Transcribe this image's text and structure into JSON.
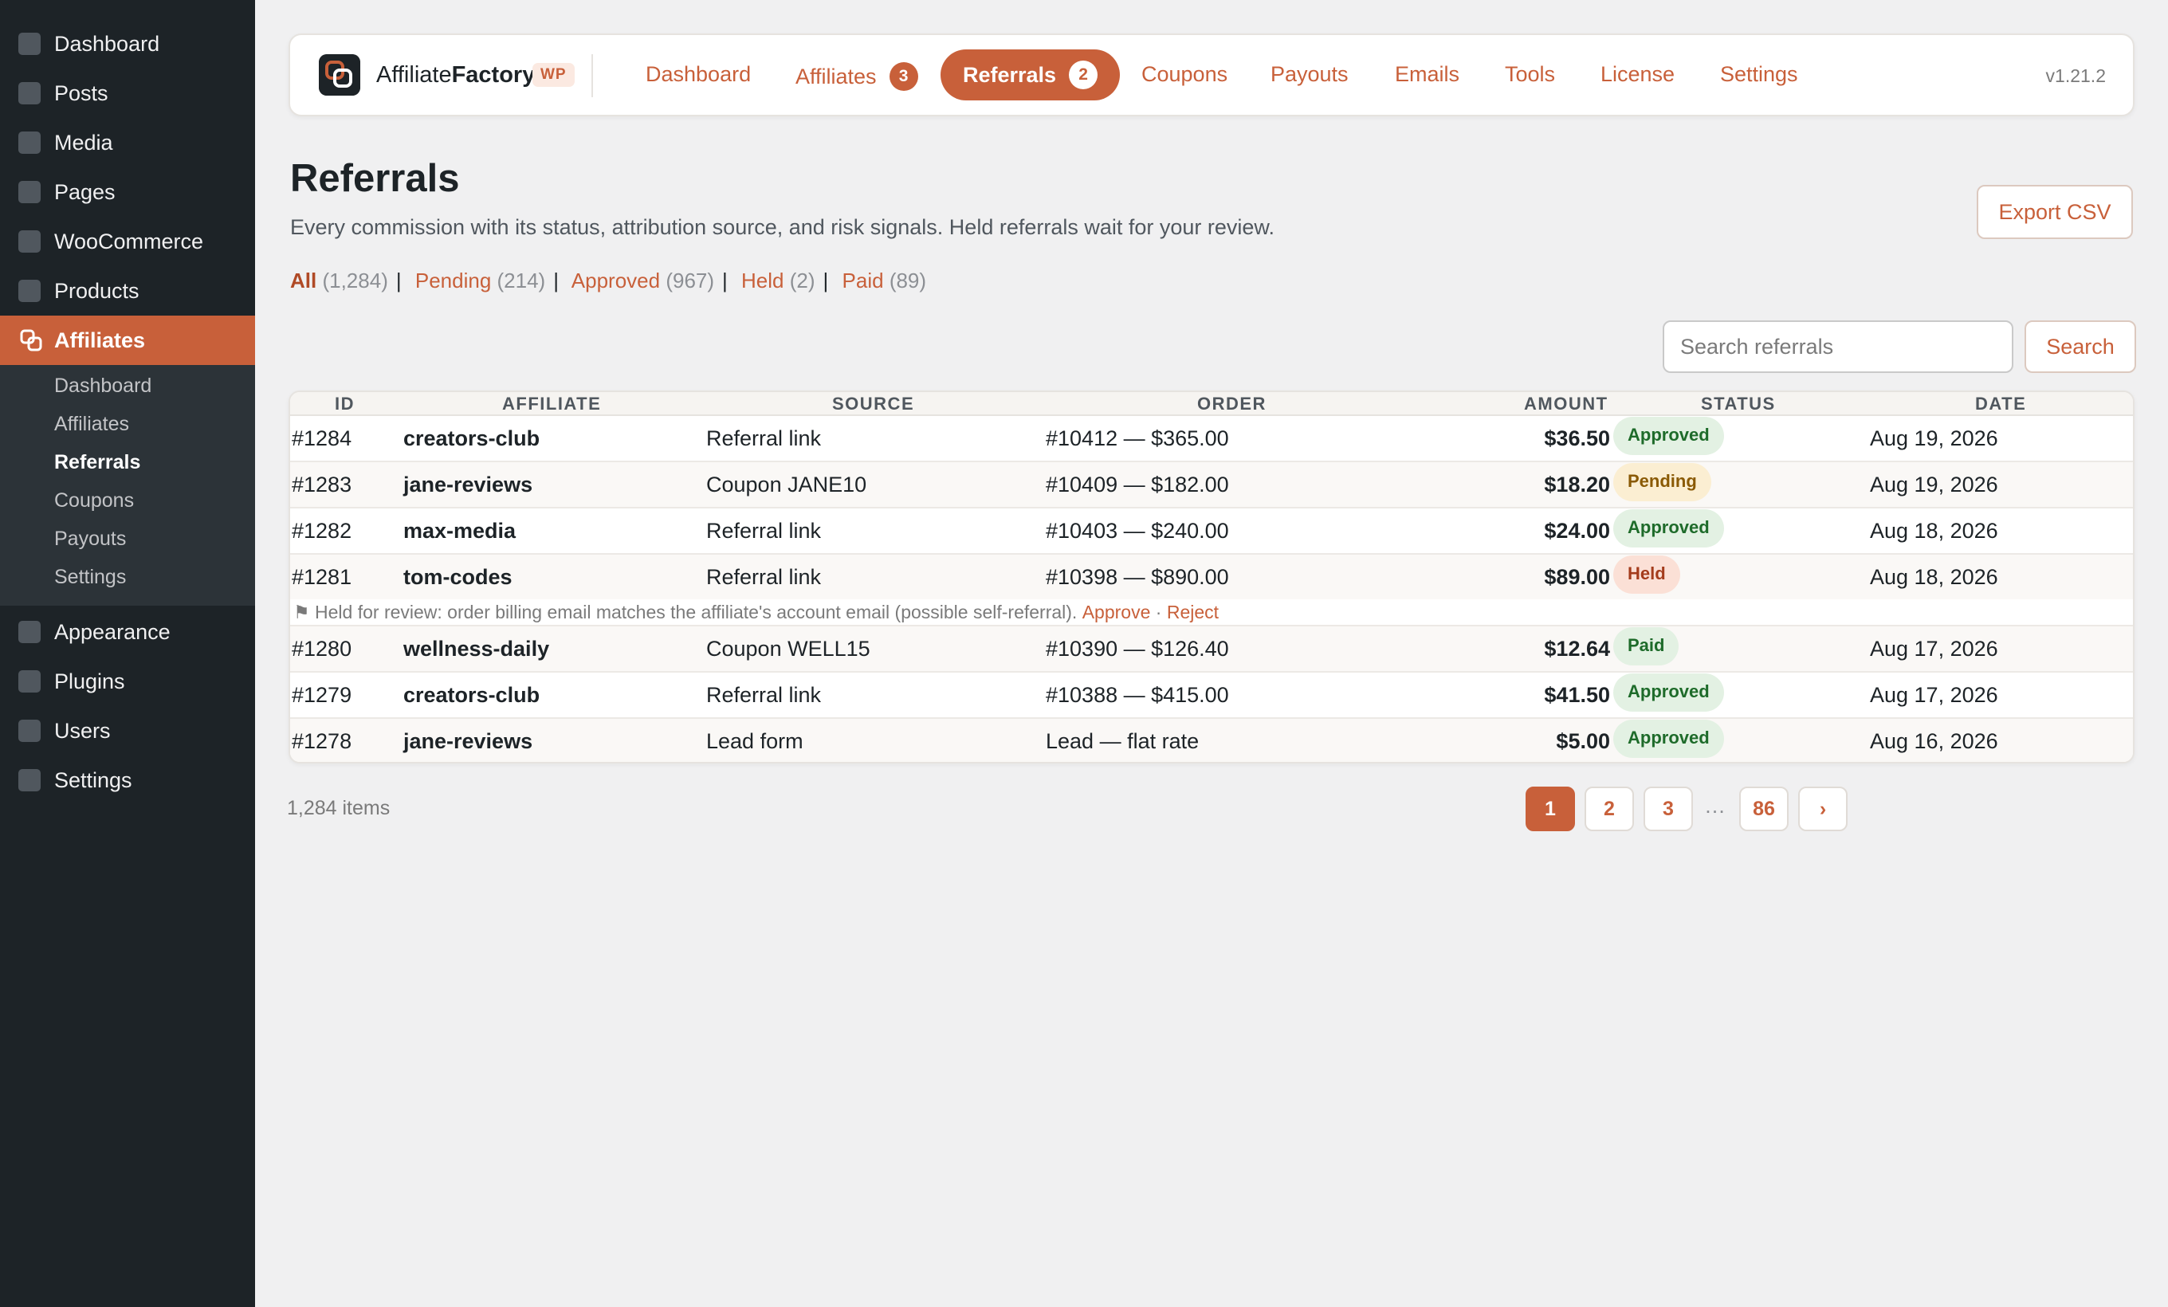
{
  "sidebar": {
    "items": [
      {
        "label": "Dashboard"
      },
      {
        "label": "Posts"
      },
      {
        "label": "Media"
      },
      {
        "label": "Pages"
      },
      {
        "label": "WooCommerce"
      },
      {
        "label": "Products"
      },
      {
        "label": "Affiliates"
      },
      {
        "label": "Appearance"
      },
      {
        "label": "Plugins"
      },
      {
        "label": "Users"
      },
      {
        "label": "Settings"
      }
    ],
    "submenu": [
      "Dashboard",
      "Affiliates",
      "Referrals",
      "Coupons",
      "Payouts",
      "Settings"
    ],
    "submenu_current": "Referrals"
  },
  "brand": {
    "name_prefix": "Affiliate",
    "name_bold": "Factory",
    "badge": "WP",
    "icon": "affiliate-factory-logo-icon"
  },
  "topnav": {
    "tabs": [
      {
        "label": "Dashboard"
      },
      {
        "label": "Affiliates",
        "count": "3"
      },
      {
        "label": "Referrals",
        "count": "2"
      },
      {
        "label": "Coupons"
      },
      {
        "label": "Payouts"
      },
      {
        "label": "Emails"
      },
      {
        "label": "Tools"
      },
      {
        "label": "License"
      },
      {
        "label": "Settings"
      }
    ],
    "active_tab": "Referrals",
    "version": "v1.21.2"
  },
  "page": {
    "title": "Referrals",
    "description": "Every commission with its status, attribution source, and risk signals. Held referrals wait for your review.",
    "export_label": "Export CSV"
  },
  "filters": [
    {
      "label": "All",
      "count": "(1,284)"
    },
    {
      "label": "Pending",
      "count": "(214)"
    },
    {
      "label": "Approved",
      "count": "(967)"
    },
    {
      "label": "Held",
      "count": "(2)"
    },
    {
      "label": "Paid",
      "count": "(89)"
    }
  ],
  "search": {
    "placeholder": "Search referrals",
    "button": "Search"
  },
  "table": {
    "headers": {
      "id": "ID",
      "affiliate": "AFFILIATE",
      "source": "SOURCE",
      "order": "ORDER",
      "amount": "AMOUNT",
      "status": "STATUS",
      "date": "DATE"
    },
    "rows": [
      {
        "id": "#1284",
        "affiliate": "creators-club",
        "source": "Referral link",
        "order": "#10412 — $365.00",
        "amount": "$36.50",
        "status": "Approved",
        "date": "Aug 19, 2026"
      },
      {
        "id": "#1283",
        "affiliate": "jane-reviews",
        "source": "Coupon JANE10",
        "order": "#10409 — $182.00",
        "amount": "$18.20",
        "status": "Pending",
        "date": "Aug 19, 2026"
      },
      {
        "id": "#1282",
        "affiliate": "max-media",
        "source": "Referral link",
        "order": "#10403 — $240.00",
        "amount": "$24.00",
        "status": "Approved",
        "date": "Aug 18, 2026"
      },
      {
        "id": "#1281",
        "affiliate": "tom-codes",
        "source": "Referral link",
        "order": "#10398 — $890.00",
        "amount": "$89.00",
        "status": "Held",
        "date": "Aug 18, 2026"
      },
      {
        "id": "#1280",
        "affiliate": "wellness-daily",
        "source": "Coupon WELL15",
        "order": "#10390 — $126.40",
        "amount": "$12.64",
        "status": "Paid",
        "date": "Aug 17, 2026"
      },
      {
        "id": "#1279",
        "affiliate": "creators-club",
        "source": "Referral link",
        "order": "#10388 — $415.00",
        "amount": "$41.50",
        "status": "Approved",
        "date": "Aug 17, 2026"
      },
      {
        "id": "#1278",
        "affiliate": "jane-reviews",
        "source": "Lead form",
        "order": "Lead — flat rate",
        "amount": "$5.00",
        "status": "Approved",
        "date": "Aug 16, 2026"
      }
    ],
    "held_note": {
      "icon": "⚑",
      "text": "Held for review: order billing email matches the affiliate's account email (possible self-referral).",
      "approve": "Approve",
      "separator": "·",
      "reject": "Reject"
    }
  },
  "status_colors": {
    "Approved": "#1e6b2a",
    "Pending": "#8a5a05",
    "Held": "#a43c1c",
    "Paid": "#1e6b2a"
  },
  "accent_color": "#c8603a",
  "pagination": {
    "items_label": "1,284 items",
    "pages": [
      "1",
      "2",
      "3",
      "86"
    ],
    "ellipsis": "…",
    "next": "›",
    "current": "1"
  }
}
